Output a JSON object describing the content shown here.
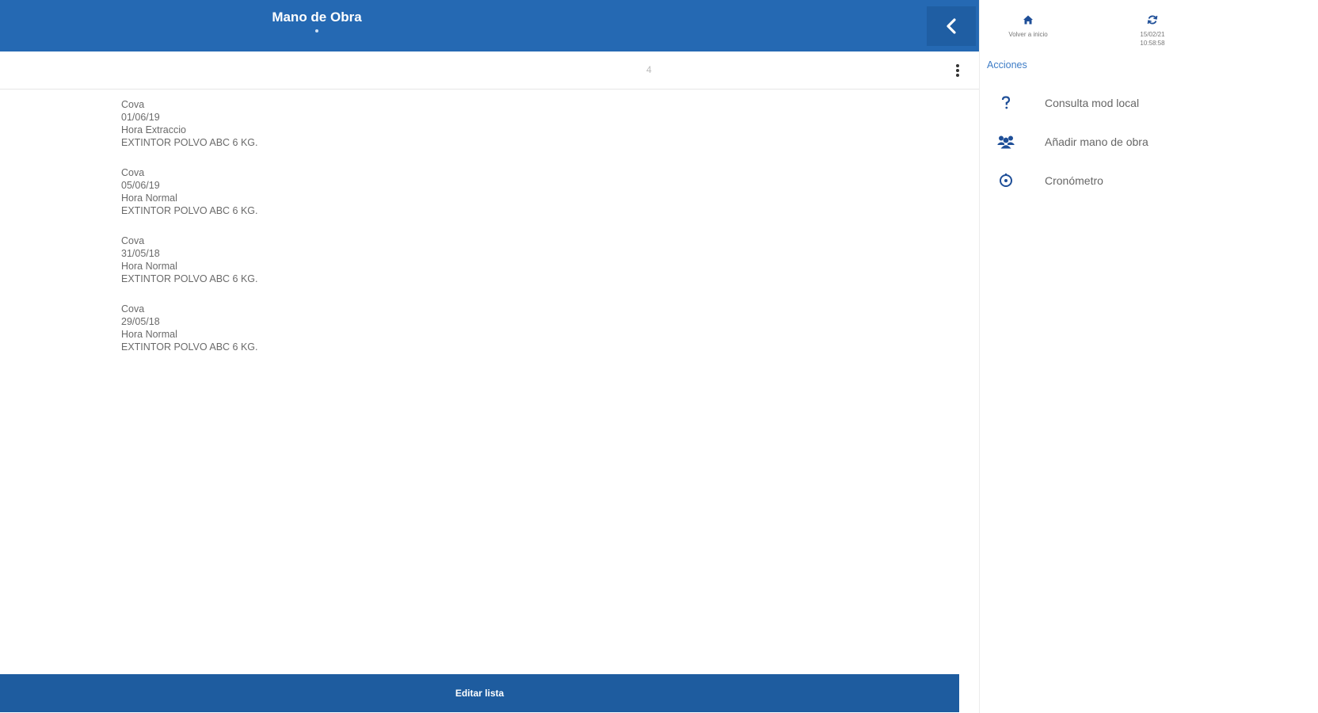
{
  "header": {
    "title": "Mano de Obra"
  },
  "toolbar": {
    "count": "4"
  },
  "entries": [
    {
      "name": "Cova",
      "date": "01/06/19",
      "hour_type": "Hora Extraccio",
      "item": "EXTINTOR POLVO ABC 6 KG."
    },
    {
      "name": "Cova",
      "date": "05/06/19",
      "hour_type": "Hora Normal",
      "item": "EXTINTOR POLVO ABC 6 KG."
    },
    {
      "name": "Cova",
      "date": "31/05/18",
      "hour_type": "Hora Normal",
      "item": "EXTINTOR POLVO ABC 6 KG."
    },
    {
      "name": "Cova",
      "date": "29/05/18",
      "hour_type": "Hora Normal",
      "item": "EXTINTOR POLVO ABC 6 KG."
    }
  ],
  "footer": {
    "button_label": "Editar lista"
  },
  "side_panel": {
    "home": {
      "icon": "home-icon",
      "caption": "Volver a inicio"
    },
    "sync": {
      "icon": "sync-icon",
      "caption_line1": "15/02/21",
      "caption_line2": "10:58:58"
    },
    "section_title": "Acciones",
    "actions": [
      {
        "icon": "question-icon",
        "label": "Consulta mod local"
      },
      {
        "icon": "users-icon",
        "label": "Añadir mano de obra"
      },
      {
        "icon": "stopwatch-icon",
        "label": "Cronómetro"
      }
    ]
  },
  "colors": {
    "primary": "#2569b3",
    "primary_dark": "#1e5c9f",
    "accent_text": "#3d7cc6",
    "icon": "#1f4f98"
  }
}
